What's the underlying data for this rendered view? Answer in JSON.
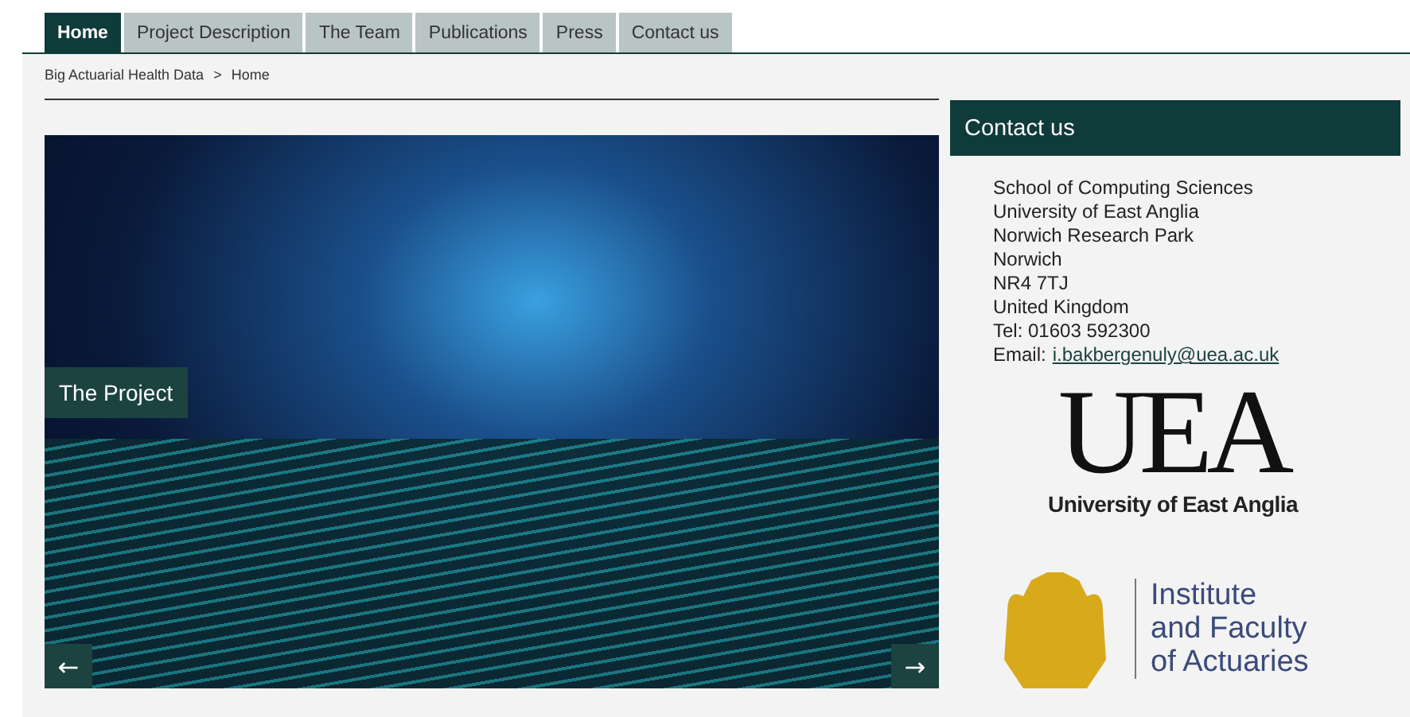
{
  "tabs": [
    {
      "label": "Home",
      "selected": true
    },
    {
      "label": "Project Description",
      "selected": false
    },
    {
      "label": "The Team",
      "selected": false
    },
    {
      "label": "Publications",
      "selected": false
    },
    {
      "label": "Press",
      "selected": false
    },
    {
      "label": "Contact us",
      "selected": false
    }
  ],
  "breadcrumb": [
    {
      "label": "Big Actuarial Health Data"
    },
    {
      "label": ">"
    },
    {
      "label": "Home"
    }
  ],
  "slider": {
    "caption": "The Project",
    "prev": "←",
    "next": "→"
  },
  "contact": {
    "title": "Contact us",
    "lines": [
      "School of Computing Sciences",
      "University of East Anglia",
      "Norwich Research Park",
      "Norwich",
      "NR4 7TJ",
      "United Kingdom",
      "Tel: 01603 592300"
    ],
    "email_label": "Email:",
    "email": "i.bakbergenuly@uea.ac.uk"
  },
  "logos": {
    "uea_mark": "UEA",
    "uea_name": "University of East Anglia",
    "ifoa_lines": [
      "Institute",
      "and Faculty",
      "of Actuaries"
    ]
  }
}
